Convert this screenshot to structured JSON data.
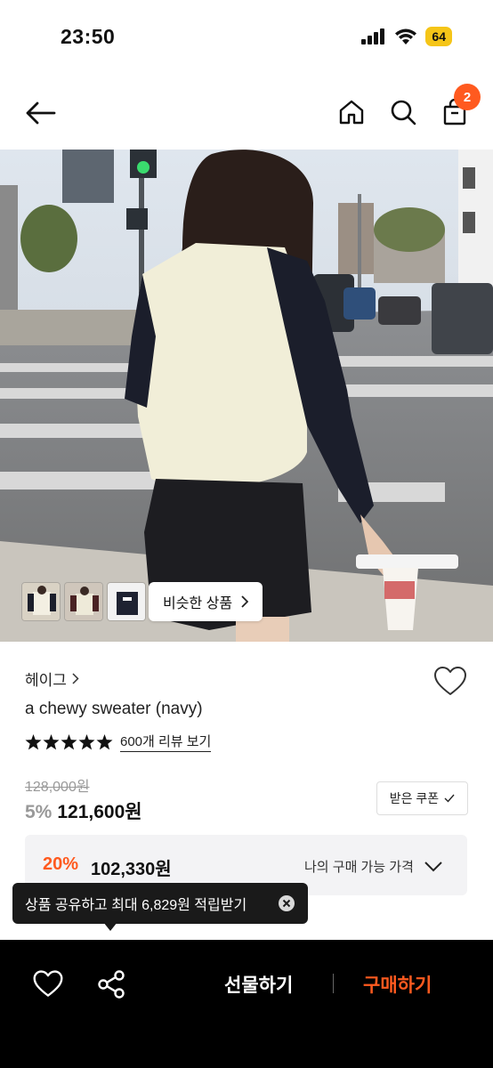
{
  "status_bar": {
    "time": "23:50",
    "battery": "64"
  },
  "header": {
    "cart_count": "2",
    "icons": [
      "back-arrow-icon",
      "home-icon",
      "search-icon",
      "shopping-bag-icon"
    ]
  },
  "hero": {
    "similar_button": "비슷한 상품"
  },
  "product": {
    "brand": "헤이그",
    "name": "a chewy sweater (navy)",
    "rating_stars": 5,
    "review_link": "600개 리뷰 보기",
    "original_price": "128,000원",
    "discount_percent": "5%",
    "sale_price": "121,600원",
    "coupon_button": "받은 쿠폰"
  },
  "my_price": {
    "discount_percent": "20%",
    "price": "102,330원",
    "label": "나의 구매 가능 가격"
  },
  "tooltip": {
    "text": "상품 공유하고 최대 6,829원 적립받기"
  },
  "bottom_bar": {
    "gift_button": "선물하기",
    "buy_button": "구매하기"
  },
  "colors": {
    "accent": "#ff5a1f",
    "bar": "#000000",
    "battery": "#f5c518"
  }
}
